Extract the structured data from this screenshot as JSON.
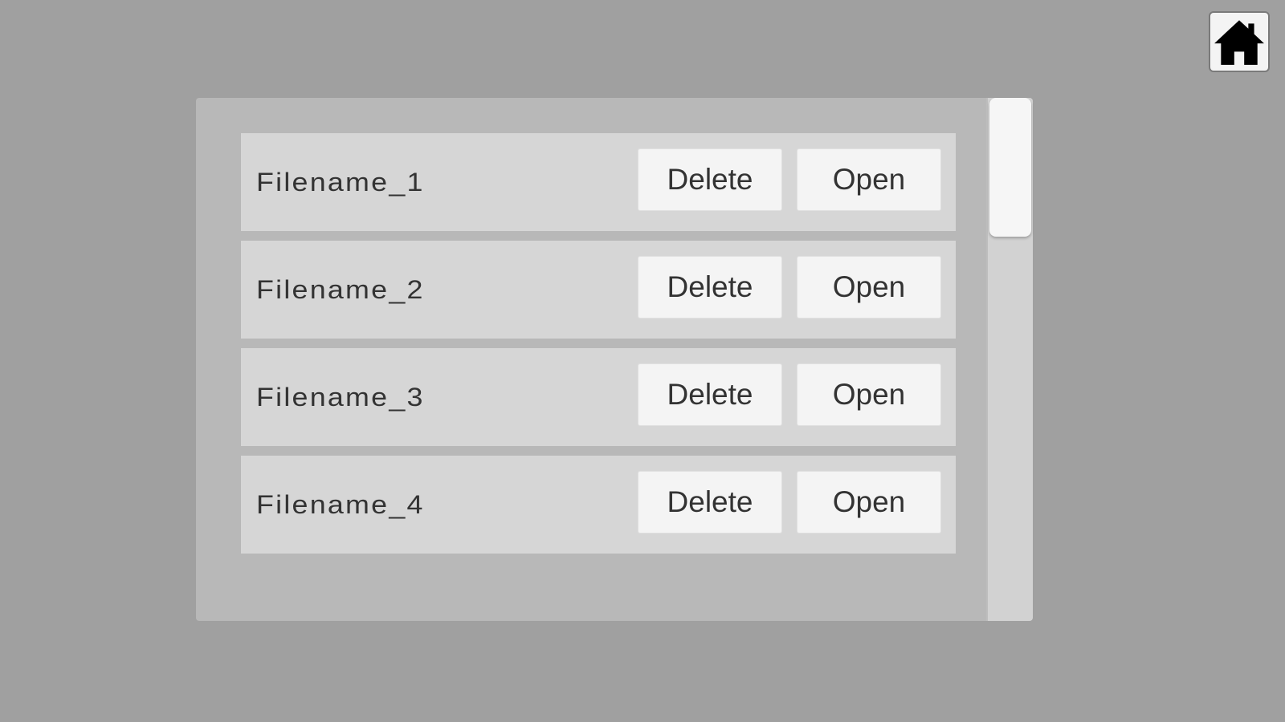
{
  "home": {
    "icon": "home-icon"
  },
  "files": [
    {
      "name": "Filename_1",
      "delete_label": "Delete",
      "open_label": "Open"
    },
    {
      "name": "Filename_2",
      "delete_label": "Delete",
      "open_label": "Open"
    },
    {
      "name": "Filename_3",
      "delete_label": "Delete",
      "open_label": "Open"
    },
    {
      "name": "Filename_4",
      "delete_label": "Delete",
      "open_label": "Open"
    }
  ],
  "colors": {
    "background": "#a0a0a0",
    "panel": "#b8b8b8",
    "row": "#d6d6d6",
    "button": "#f4f4f4",
    "text": "#333333"
  }
}
